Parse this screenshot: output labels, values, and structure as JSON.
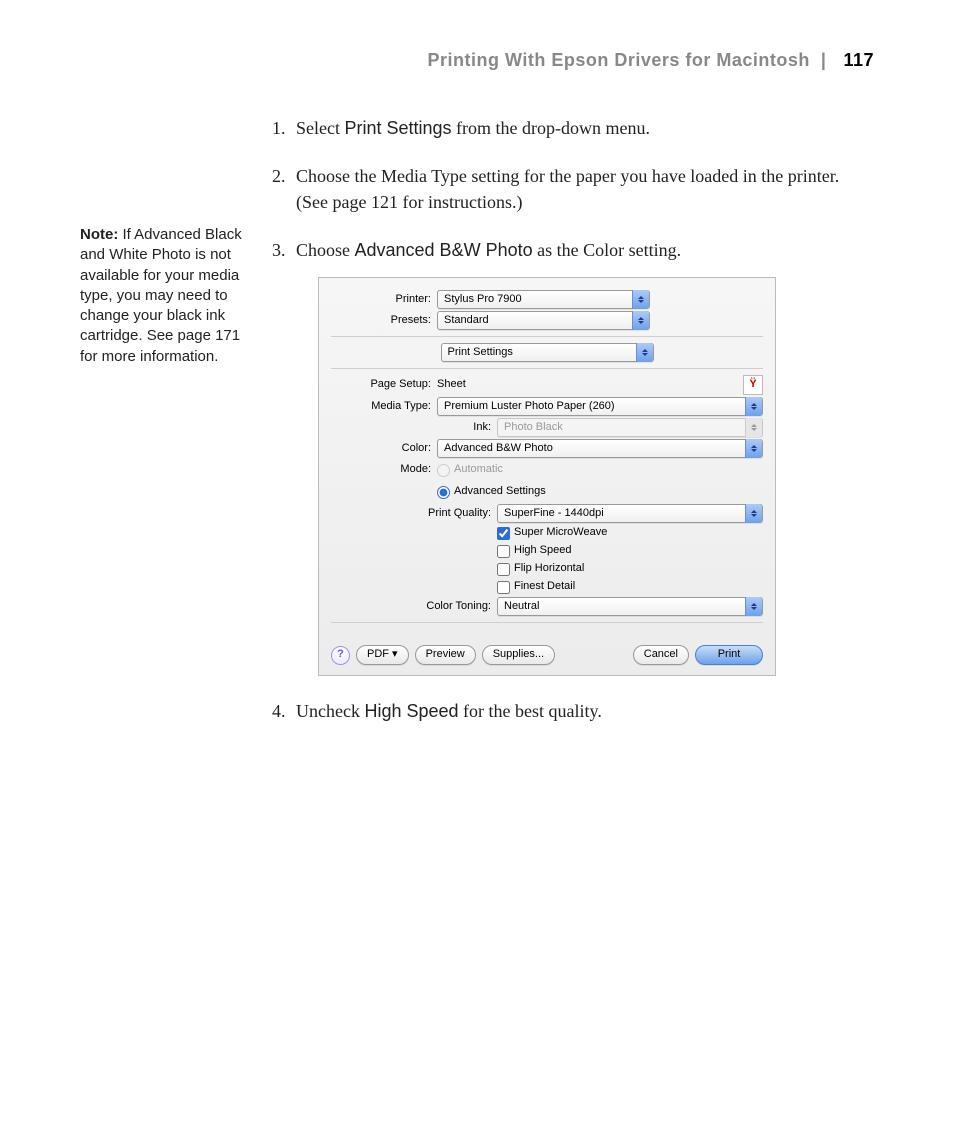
{
  "header": {
    "title": "Printing With Epson Drivers for Macintosh",
    "sep": "|",
    "page": "117"
  },
  "sidebar": {
    "note_label": "Note:",
    "note_text": " If Advanced Black and White Photo is not available for your media type, you may need to change your black ink cartridge. See page 171 for more information."
  },
  "steps": {
    "s1a": "Select ",
    "s1b": "Print Settings",
    "s1c": " from the drop-down menu.",
    "s2": "Choose the Media Type setting for the paper you have loaded in the printer. (See page 121 for instructions.)",
    "s3a": "Choose ",
    "s3b": "Advanced B&W Photo",
    "s3c": " as the Color setting.",
    "s4a": "Uncheck ",
    "s4b": "High Speed",
    "s4c": " for the best quality."
  },
  "dialog": {
    "labels": {
      "printer": "Printer:",
      "presets": "Presets:",
      "page_setup": "Page Setup:",
      "media_type": "Media Type:",
      "ink": "Ink:",
      "color": "Color:",
      "mode": "Mode:",
      "print_quality": "Print Quality:",
      "color_toning": "Color Toning:"
    },
    "values": {
      "printer": "Stylus Pro 7900",
      "presets": "Standard",
      "pane": "Print Settings",
      "page_setup": "Sheet",
      "media_type": "Premium Luster Photo Paper (260)",
      "ink": "Photo Black",
      "color": "Advanced B&W Photo",
      "mode_auto": "Automatic",
      "mode_adv": "Advanced Settings",
      "print_quality": "SuperFine - 1440dpi",
      "color_toning": "Neutral"
    },
    "checks": {
      "super_microweave": "Super MicroWeave",
      "high_speed": "High Speed",
      "flip_horizontal": "Flip Horizontal",
      "finest_detail": "Finest Detail"
    },
    "buttons": {
      "help": "?",
      "pdf": "PDF ▾",
      "preview": "Preview",
      "supplies": "Supplies...",
      "cancel": "Cancel",
      "print": "Print"
    }
  }
}
